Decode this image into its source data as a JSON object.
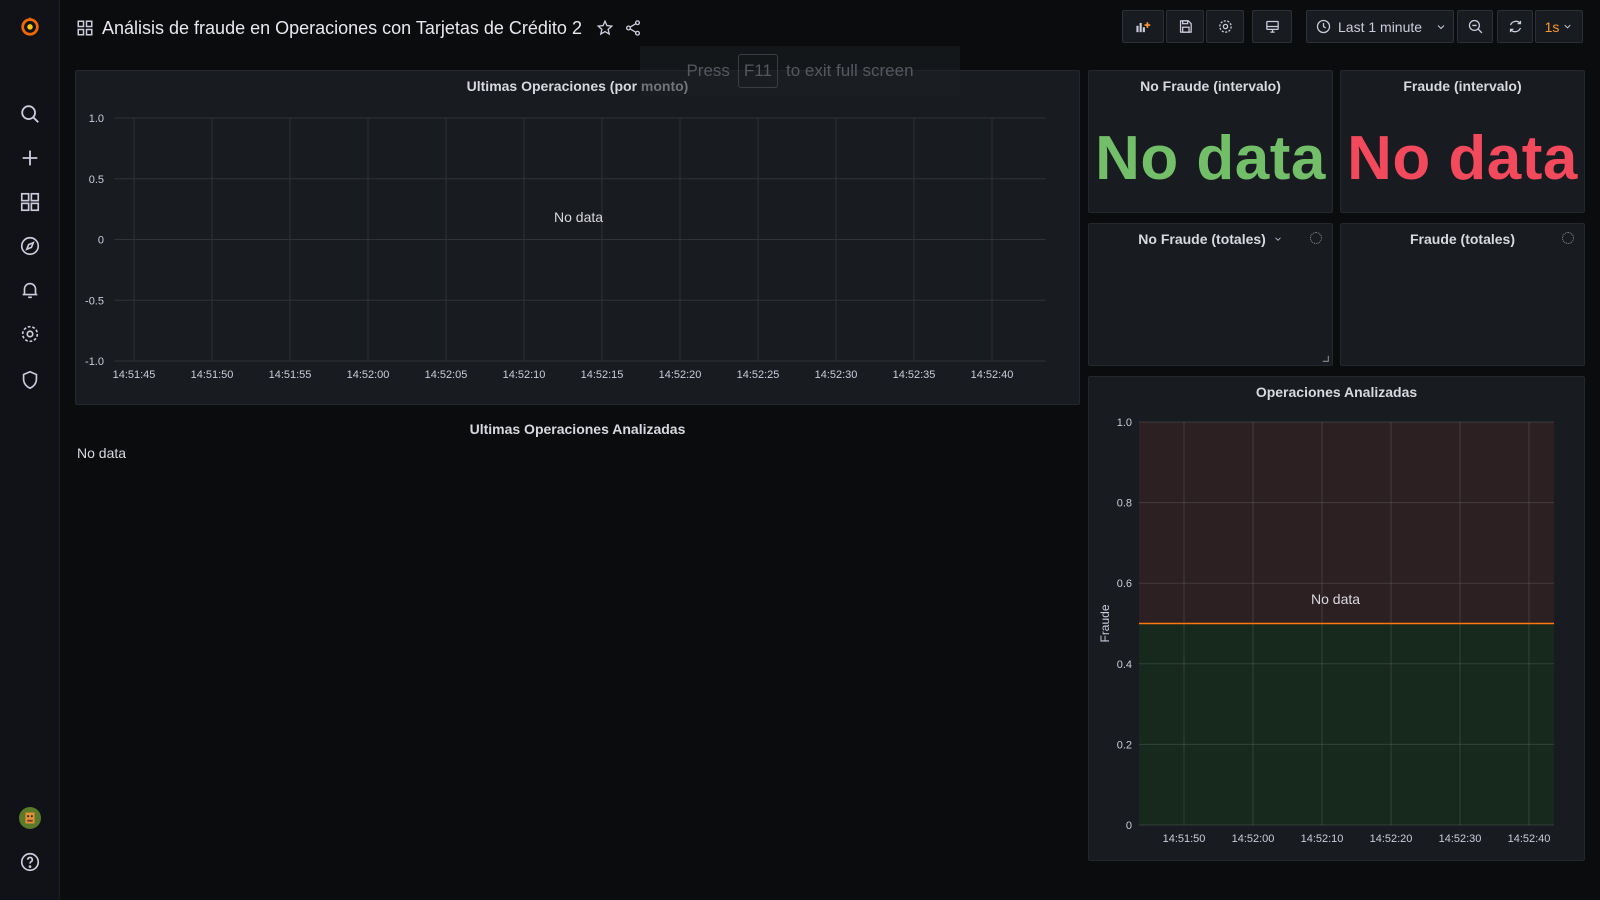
{
  "header": {
    "title": "Análisis de fraude en Operaciones con Tarjetas de Crédito 2",
    "time_range": "Last 1 minute",
    "refresh_interval": "1s"
  },
  "toast": {
    "press": "Press",
    "key": "F11",
    "rest": "to exit full screen"
  },
  "sidebar": {
    "items": [
      "grafana-logo",
      "search-icon",
      "plus-icon",
      "dashboards-icon",
      "explore-icon",
      "alerting-icon",
      "configuration-icon",
      "shield-icon",
      "avatar",
      "help-icon"
    ]
  },
  "panels": {
    "ultimas_operaciones": {
      "title": "Ultimas Operaciones (por monto)",
      "status": "No data"
    },
    "ultimas_analizadas": {
      "title": "Ultimas Operaciones Analizadas",
      "status": "No data"
    },
    "no_fraude_intervalo": {
      "title": "No Fraude (intervalo)",
      "status": "No data"
    },
    "fraude_intervalo": {
      "title": "Fraude (intervalo)",
      "status": "No data"
    },
    "no_fraude_totales": {
      "title": "No Fraude (totales)"
    },
    "fraude_totales": {
      "title": "Fraude (totales)"
    },
    "operaciones_analizadas": {
      "title": "Operaciones Analizadas",
      "status": "No data"
    }
  },
  "colors": {
    "green": "#73bf69",
    "red": "#f2495c",
    "accent": "#ff780a",
    "threshold": "#ff780a"
  },
  "chart_data": [
    {
      "type": "line",
      "title": "Ultimas Operaciones (por monto)",
      "x_ticks": [
        "14:51:45",
        "14:51:50",
        "14:51:55",
        "14:52:00",
        "14:52:05",
        "14:52:10",
        "14:52:15",
        "14:52:20",
        "14:52:25",
        "14:52:30",
        "14:52:35",
        "14:52:40"
      ],
      "y_ticks": [
        "1.0",
        "0.5",
        "0",
        "-0.5",
        "-1.0"
      ],
      "ylim": [
        -1,
        1
      ],
      "series": [],
      "grid": true
    },
    {
      "type": "line",
      "title": "Operaciones Analizadas",
      "ylabel": "Fraude",
      "x_ticks": [
        "14:51:50",
        "14:52:00",
        "14:52:10",
        "14:52:20",
        "14:52:30",
        "14:52:40"
      ],
      "y_ticks": [
        "1.0",
        "0.8",
        "0.6",
        "0.4",
        "0.2",
        "0"
      ],
      "ylim": [
        0,
        1
      ],
      "threshold": 0.5,
      "series": [],
      "grid": true
    }
  ]
}
